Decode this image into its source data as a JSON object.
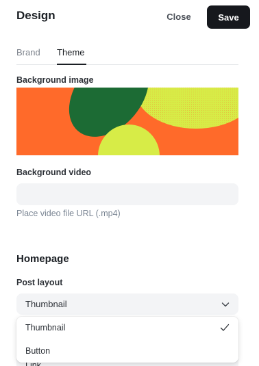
{
  "header": {
    "title": "Design",
    "close_label": "Close",
    "save_label": "Save"
  },
  "tabs": [
    {
      "label": "Brand",
      "active": false
    },
    {
      "label": "Theme",
      "active": true
    }
  ],
  "background_image": {
    "label": "Background image",
    "colors": {
      "background": "#ff6a2a",
      "dark_green": "#1c6b34",
      "lime": "#d7ec47"
    }
  },
  "background_video": {
    "label": "Background video",
    "value": "",
    "hint": "Place video file URL (.mp4)"
  },
  "homepage": {
    "section_title": "Homepage",
    "post_layout_label": "Post layout",
    "selected": "Thumbnail",
    "options": [
      {
        "label": "Thumbnail",
        "checked": true
      },
      {
        "label": "Button",
        "checked": false
      }
    ],
    "hidden_item_label": "Link"
  },
  "icons": {
    "chevron": "chevron-down-icon",
    "check": "check-icon"
  }
}
